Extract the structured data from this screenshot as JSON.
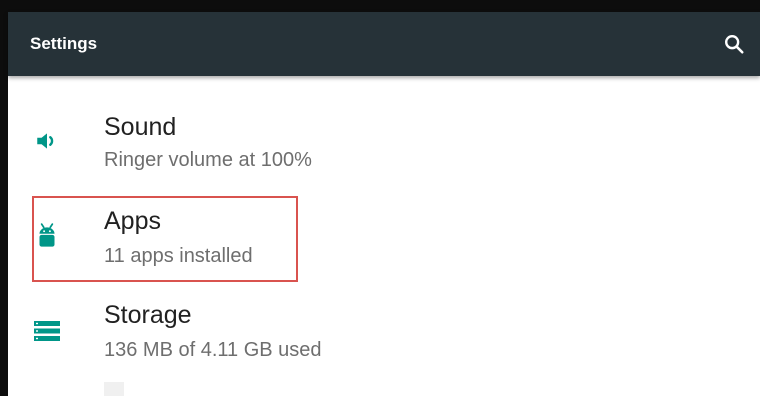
{
  "appbar": {
    "title": "Settings",
    "search_icon": "search-icon",
    "background": "#263238"
  },
  "settings": {
    "items": [
      {
        "title": "Sound",
        "subtitle": "Ringer volume at 100%",
        "icon": "volume-icon"
      },
      {
        "title": "Apps",
        "subtitle": "11 apps installed",
        "icon": "android-icon"
      },
      {
        "title": "Storage",
        "subtitle": "136 MB of 4.11 GB used",
        "icon": "storage-icon"
      }
    ],
    "icon_color": "#009688"
  },
  "annotation": {
    "highlight_color": "#d9534f"
  }
}
